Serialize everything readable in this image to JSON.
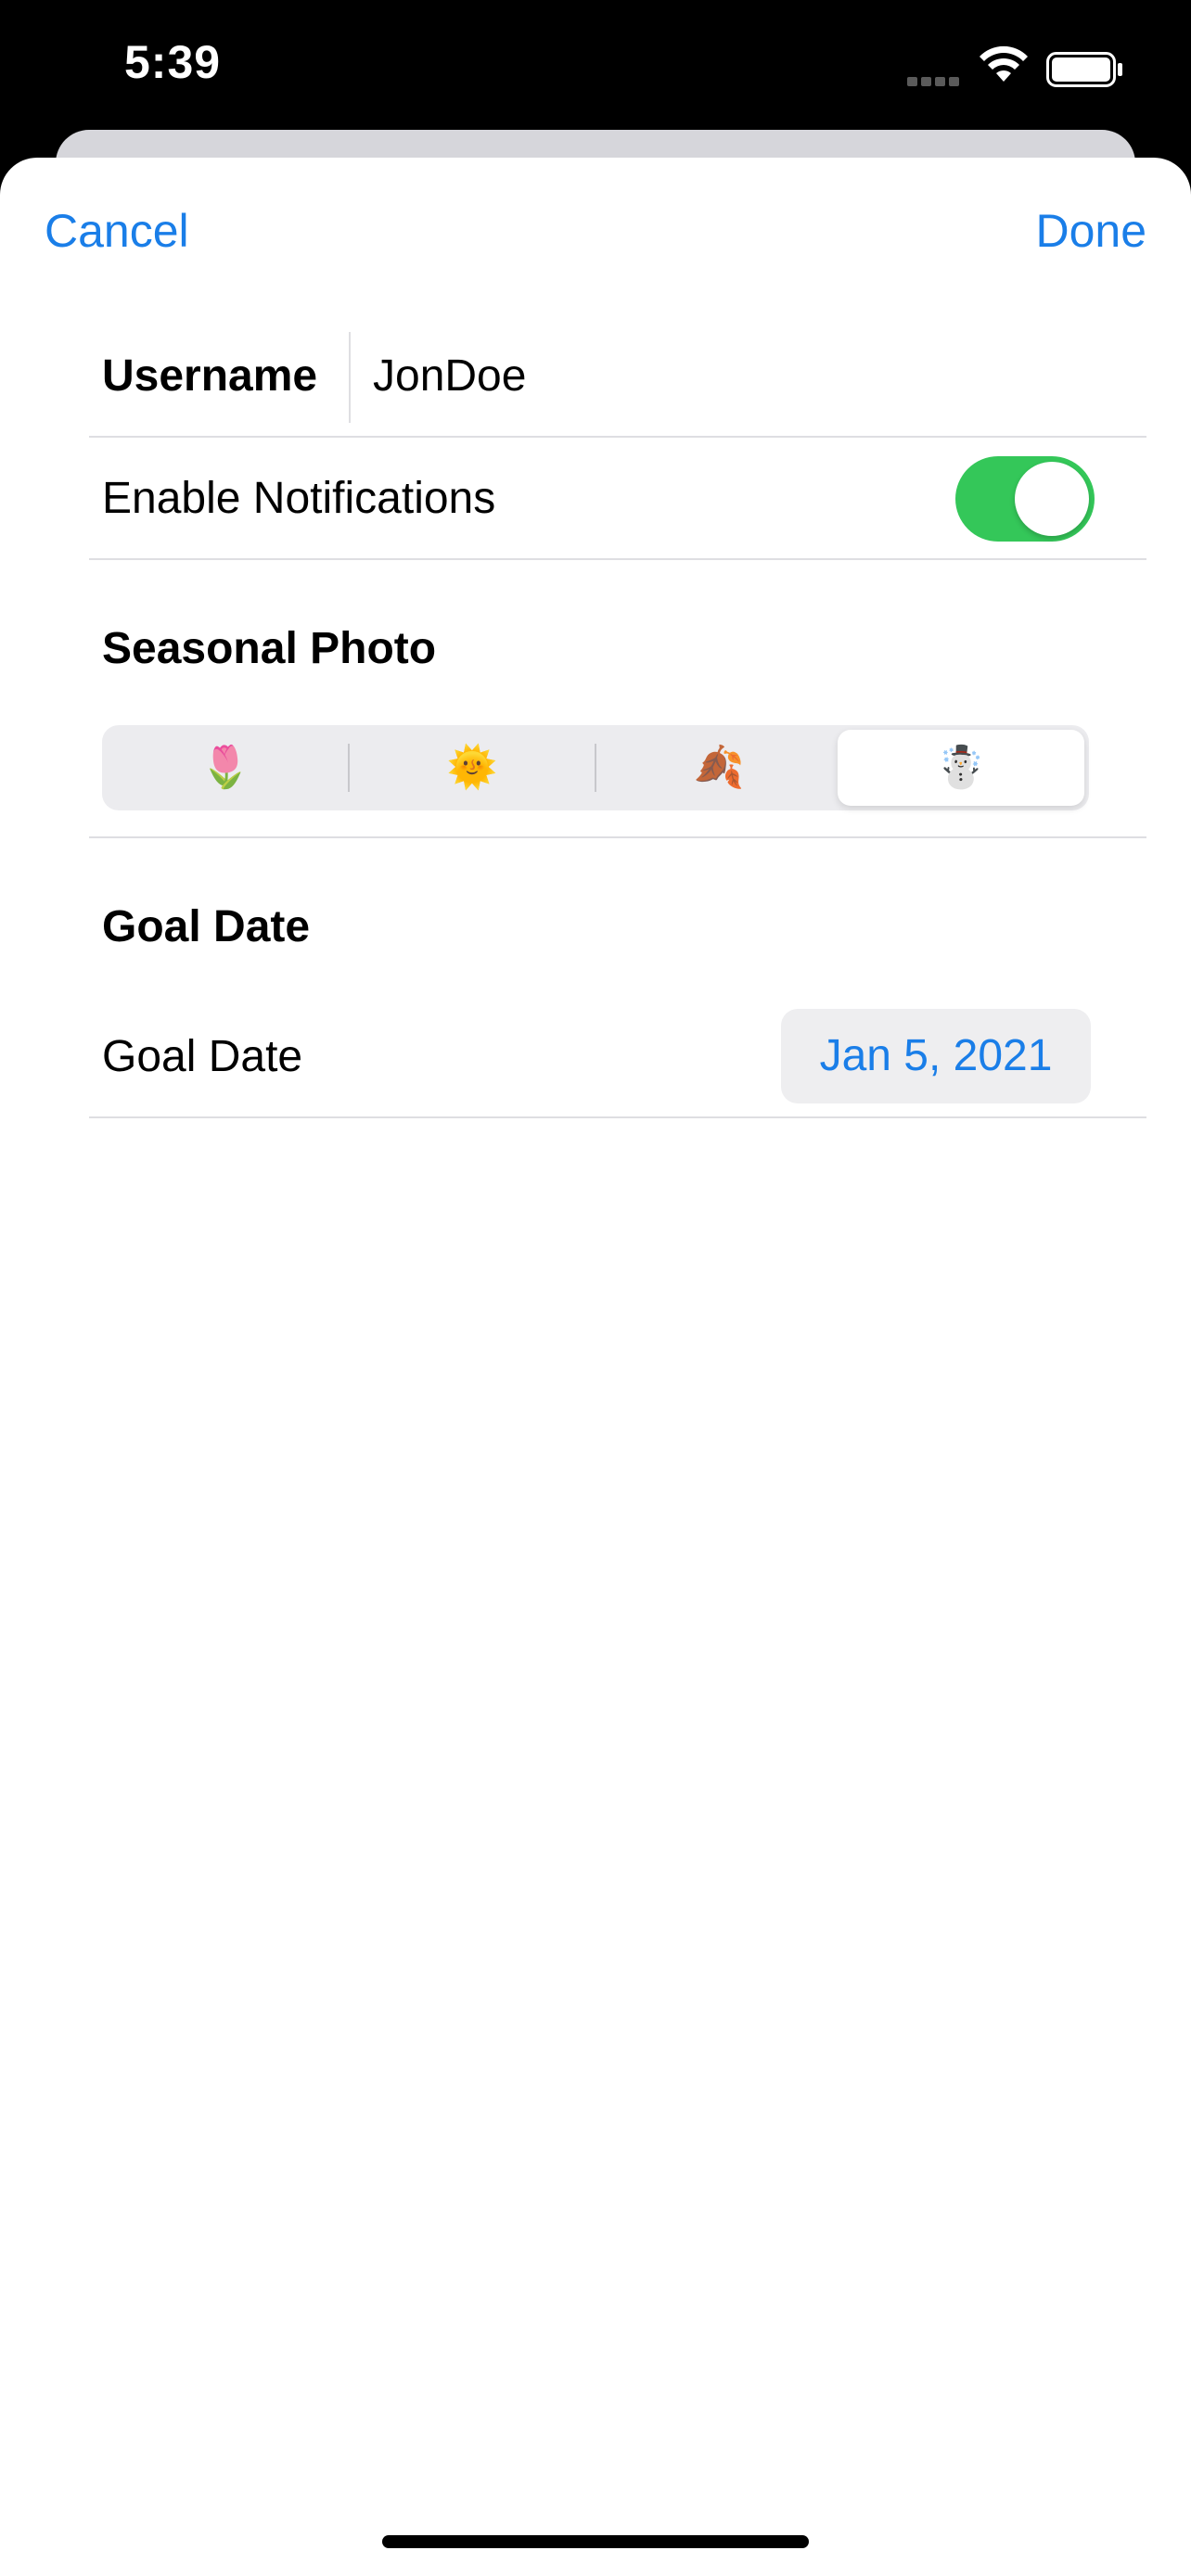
{
  "status_bar": {
    "time": "5:39",
    "signal_icon": "cellular-signal-icon",
    "wifi_icon": "wifi-icon",
    "battery_icon": "battery-full-icon"
  },
  "nav": {
    "cancel_label": "Cancel",
    "done_label": "Done"
  },
  "form": {
    "username": {
      "label": "Username",
      "value": "JonDoe"
    },
    "notifications": {
      "label": "Enable Notifications",
      "enabled": true
    },
    "seasonal_photo": {
      "title": "Seasonal Photo",
      "options": [
        "🌷",
        "🌞",
        "🍂",
        "☃️"
      ],
      "selected_index": 3
    },
    "goal_date": {
      "section_title": "Goal Date",
      "label": "Goal Date",
      "value": "Jan 5, 2021"
    }
  },
  "colors": {
    "accent": "#1a7ee8",
    "toggle_on": "#34c759",
    "separator": "#dedee2",
    "segment_background": "#ececef"
  }
}
